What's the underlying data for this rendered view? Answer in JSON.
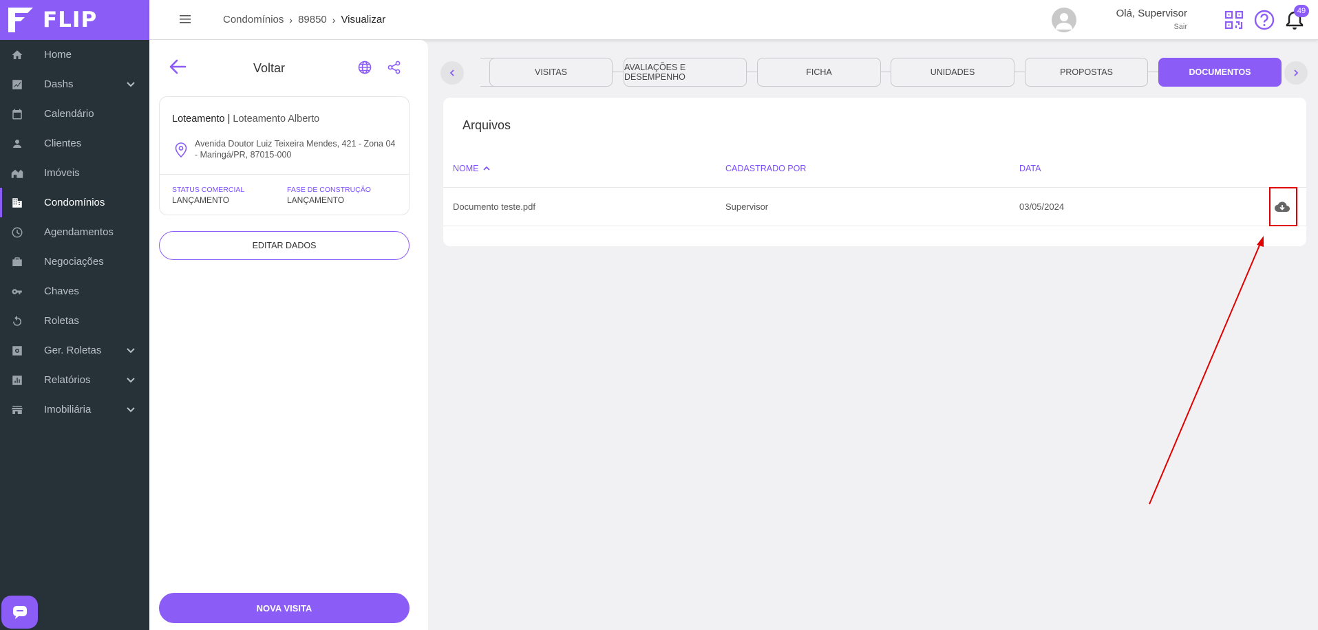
{
  "app": {
    "brand": "FLIP",
    "accent_color": "#8b5cf6"
  },
  "sidebar": {
    "items": [
      {
        "label": "Home",
        "icon": "home-icon",
        "has_submenu": false,
        "active": false
      },
      {
        "label": "Dashs",
        "icon": "chart-icon",
        "has_submenu": true,
        "active": false
      },
      {
        "label": "Calendário",
        "icon": "calendar-icon",
        "has_submenu": false,
        "active": false
      },
      {
        "label": "Clientes",
        "icon": "person-icon",
        "has_submenu": false,
        "active": false
      },
      {
        "label": "Imóveis",
        "icon": "house-icon",
        "has_submenu": false,
        "active": false
      },
      {
        "label": "Condomínios",
        "icon": "building-icon",
        "has_submenu": false,
        "active": true
      },
      {
        "label": "Agendamentos",
        "icon": "clock-icon",
        "has_submenu": false,
        "active": false
      },
      {
        "label": "Negociações",
        "icon": "briefcase-icon",
        "has_submenu": false,
        "active": false
      },
      {
        "label": "Chaves",
        "icon": "key-icon",
        "has_submenu": false,
        "active": false
      },
      {
        "label": "Roletas",
        "icon": "refresh-icon",
        "has_submenu": false,
        "active": false
      },
      {
        "label": "Ger. Roletas",
        "icon": "settings-box-icon",
        "has_submenu": true,
        "active": false
      },
      {
        "label": "Relatórios",
        "icon": "report-icon",
        "has_submenu": true,
        "active": false
      },
      {
        "label": "Imobiliária",
        "icon": "store-icon",
        "has_submenu": true,
        "active": false
      }
    ]
  },
  "topbar": {
    "breadcrumb": [
      "Condomínios",
      "89850",
      "Visualizar"
    ],
    "breadcrumb_sep": "›",
    "user_greeting": "Olá, Supervisor",
    "logout_label": "Sair",
    "notification_count": "49"
  },
  "panel": {
    "back_label": "Voltar",
    "card": {
      "type": "Loteamento",
      "separator": " | ",
      "name": "Loteamento Alberto",
      "address": "Avenida Doutor Luiz Teixeira Mendes, 421 - Zona 04 - Maringá/PR, 87015-000",
      "status_label": "STATUS COMERCIAL",
      "status_value": "LANÇAMENTO",
      "phase_label": "FASE DE CONSTRUÇÃO",
      "phase_value": "LANÇAMENTO"
    },
    "edit_button": "EDITAR DADOS",
    "new_visit_button": "NOVA VISITA"
  },
  "tabs": {
    "items": [
      "VISITAS",
      "AVALIAÇÕES E DESEMPENHO",
      "FICHA",
      "UNIDADES",
      "PROPOSTAS",
      "DOCUMENTOS"
    ],
    "active": "DOCUMENTOS"
  },
  "files": {
    "title": "Arquivos",
    "columns": {
      "name": "NOME",
      "registered_by": "CADASTRADO POR",
      "date": "DATA"
    },
    "rows": [
      {
        "name": "Documento teste.pdf",
        "registered_by": "Supervisor",
        "date": "03/05/2024"
      }
    ]
  },
  "annotation": {
    "highlight_color": "#e10000"
  }
}
